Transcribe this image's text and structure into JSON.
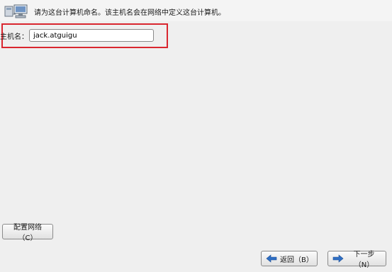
{
  "header": {
    "icon": "network-computers-icon",
    "text": "请为这台计算机命名。该主机名会在网络中定义这台计算机。"
  },
  "hostname": {
    "label": "主机名：",
    "value": "jack.atguigu"
  },
  "buttons": {
    "configure_network": "配置网络（C）",
    "back": "返回（B）",
    "next": "下一步（N）"
  },
  "colors": {
    "highlight": "#d9262f",
    "arrow": "#2f6fc4"
  }
}
